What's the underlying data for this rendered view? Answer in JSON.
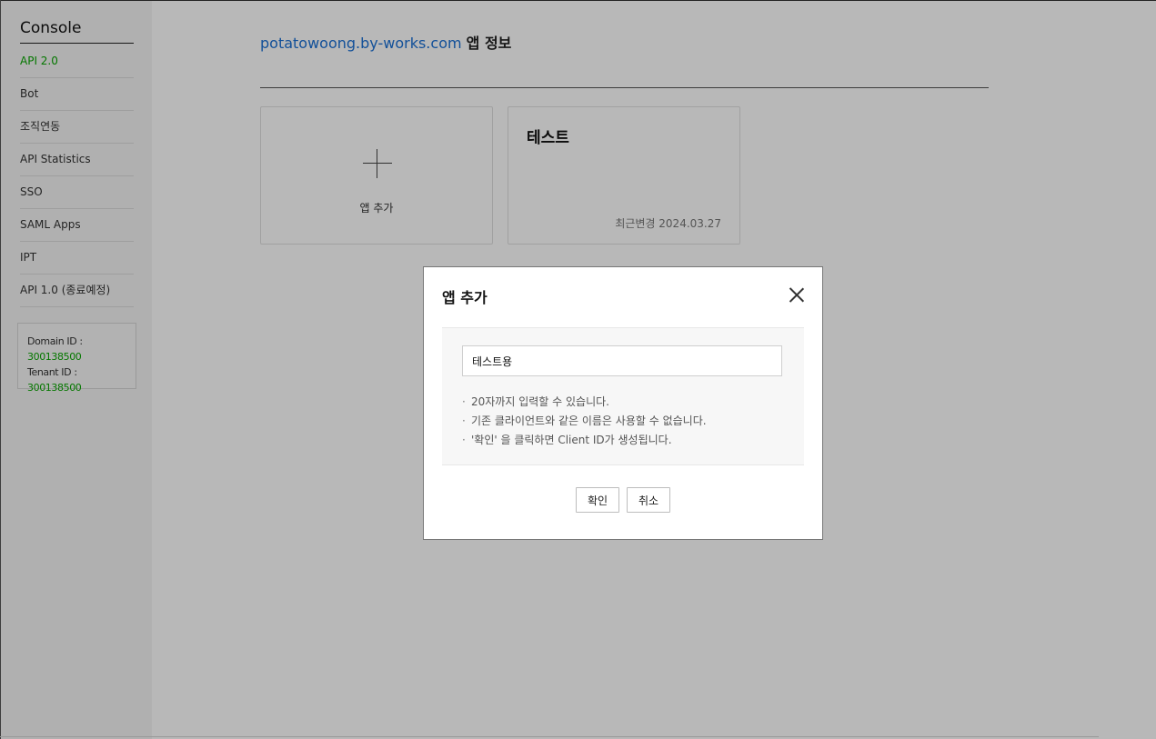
{
  "sidebar": {
    "title": "Console",
    "items": [
      {
        "label": "API 2.0",
        "active": true
      },
      {
        "label": "Bot"
      },
      {
        "label": "조직연동"
      },
      {
        "label": "API Statistics"
      },
      {
        "label": "SSO"
      },
      {
        "label": "SAML Apps"
      },
      {
        "label": "IPT"
      },
      {
        "label": "API 1.0 (종료예정)"
      }
    ],
    "domain_label": "Domain ID :",
    "domain_id": "300138500",
    "tenant_label": "Tenant ID :",
    "tenant_id": "300138500"
  },
  "main": {
    "domain": "potatowoong.by-works.com",
    "title_suffix": "앱 정보",
    "add_card_label": "앱 추가",
    "apps": [
      {
        "name": "테스트",
        "date": "최근변경 2024.03.27"
      }
    ]
  },
  "modal": {
    "title": "앱 추가",
    "input_value": "테스트용",
    "notes": [
      "20자까지 입력할 수 있습니다.",
      "기존 클라이언트와 같은 이름은 사용할 수 없습니다.",
      "'확인' 을 클릭하면 Client ID가 생성됩니다."
    ],
    "confirm_label": "확인",
    "cancel_label": "취소"
  },
  "colors": {
    "accent_green": "#08a600",
    "link_blue": "#1a6fd4"
  }
}
